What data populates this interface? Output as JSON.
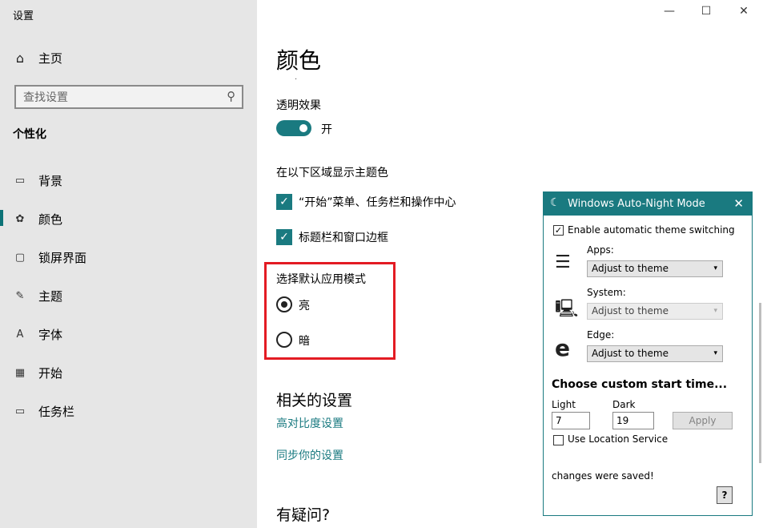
{
  "window": {
    "title": "设置",
    "minimize_glyph": "—",
    "maximize_glyph": "☐",
    "close_glyph": "✕"
  },
  "sidebar": {
    "home": {
      "icon": "home-icon",
      "label": "主页"
    },
    "search_placeholder": "查找设置",
    "section": "个性化",
    "items": [
      {
        "icon": "image-icon",
        "label": "背景"
      },
      {
        "icon": "palette-icon",
        "label": "颜色",
        "active": true
      },
      {
        "icon": "lockscreen-icon",
        "label": "锁屏界面"
      },
      {
        "icon": "theme-icon",
        "label": "主题"
      },
      {
        "icon": "font-icon",
        "label": "字体"
      },
      {
        "icon": "start-icon",
        "label": "开始"
      },
      {
        "icon": "taskbar-icon",
        "label": "任务栏"
      }
    ]
  },
  "main": {
    "title": "颜色",
    "transparency_label": "透明效果",
    "transparency_toggle": {
      "state_label": "开",
      "on": true
    },
    "accent_show_label": "在以下区域显示主题色",
    "accent_checkboxes": [
      {
        "label": "“开始”菜单、任务栏和操作中心",
        "checked": true
      },
      {
        "label": "标题栏和窗口边框",
        "checked": true
      }
    ],
    "app_mode_label": "选择默认应用模式",
    "app_mode_options": [
      {
        "label": "亮",
        "selected": true
      },
      {
        "label": "暗",
        "selected": false
      }
    ],
    "related_title": "相关的设置",
    "related_links": [
      "高对比度设置",
      "同步你的设置"
    ],
    "question_title": "有疑问?"
  },
  "dialog": {
    "title": "Windows Auto-Night Mode",
    "enable_label": "Enable automatic theme switching",
    "enable_checked": true,
    "apps_label": "Apps:",
    "apps_value": "Adjust to theme",
    "system_label": "System:",
    "system_value": "Adjust to theme",
    "edge_label": "Edge:",
    "edge_value": "Adjust to theme",
    "custom_heading": "Choose custom start time...",
    "light_label": "Light",
    "light_value": "7",
    "dark_label": "Dark",
    "dark_value": "19",
    "apply_label": "Apply",
    "location_label": "Use Location Service",
    "location_checked": false,
    "status": "changes were saved!",
    "help_label": "?"
  },
  "colors": {
    "accent": "#1a7a80",
    "highlight_border": "#e31b23",
    "sidebar_bg": "#e6e6e6"
  }
}
